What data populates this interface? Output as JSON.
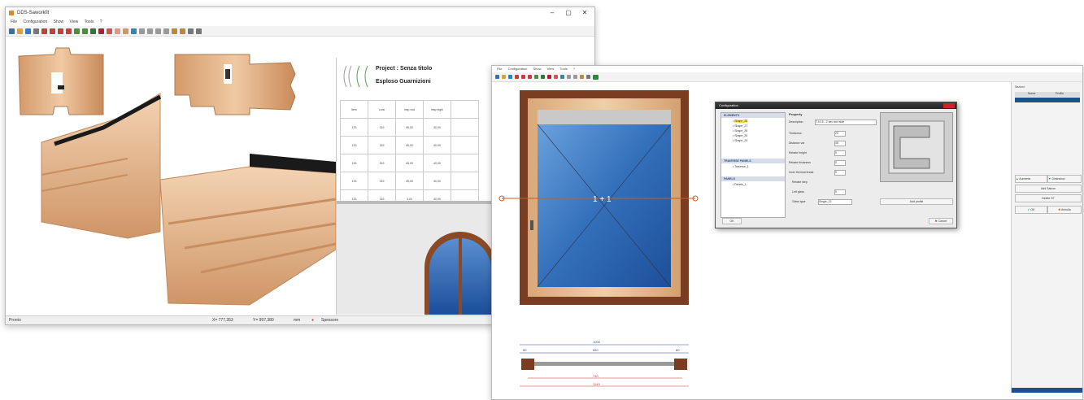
{
  "window1": {
    "title": "DDS-Saworkfit",
    "menu": [
      "File",
      "Configuration",
      "Show",
      "View",
      "Tools",
      "?"
    ],
    "status_left": "Pronto",
    "status_x": "X= 777,353",
    "status_y": "Y= 997,380",
    "status_unit": "mm",
    "status_right": "Spessore"
  },
  "report": {
    "line1": "Project : Senza titolo",
    "line2": "Esploso Guarnizioni",
    "headers": [
      "Item",
      "Lunc",
      "Insp cod",
      "Insp leghi",
      ""
    ],
    "rows": [
      [
        "133",
        "319",
        "45,00",
        "40,00",
        ""
      ],
      [
        "133",
        "319",
        "45,00",
        "40,00",
        ""
      ],
      [
        "133",
        "319",
        "45,00",
        "40,00",
        ""
      ],
      [
        "133",
        "319",
        "45,00",
        "40,00",
        ""
      ],
      [
        "133",
        "319",
        "4,00",
        "40,00",
        ""
      ]
    ]
  },
  "window2": {
    "menu": [
      "File",
      "Configuration",
      "Show",
      "View",
      "Tools",
      "?"
    ],
    "window_label": "1 + 1",
    "right_panel": {
      "header": "Sezioni",
      "col1": "Nome",
      "col2": "Profilo",
      "btn_up": "Aumenta",
      "btn_down": "Diminuisci",
      "btn_add": "Add Saloon",
      "btn_delete": "Delete ST",
      "btn_ok": "OK",
      "btn_cancel": "Annulla"
    },
    "dimensions": {
      "top": "1000",
      "second": "840",
      "left_small": "80",
      "right_small": "80",
      "bottom1": "740",
      "bottom2": "1140"
    }
  },
  "dialog": {
    "title": "Configuration",
    "list_header": "ELEMENTS",
    "list_items": [
      "Shape_25",
      "Shape_27",
      "Shape_28",
      "Shape_26",
      "Shape_24"
    ],
    "section2": "TRAVERSE PANELS",
    "section2_item": "Traverse_1",
    "section3": "PANELS",
    "section3_item": "Panels_1",
    "ok": "OK",
    "property_title": "Property",
    "props": [
      {
        "label": "Description",
        "value": "T.10.5 - 2 sec rect side"
      },
      {
        "label": "Thickness",
        "value": "20"
      },
      {
        "label": "Distance var",
        "value": "45"
      },
      {
        "label": "Rebate height",
        "value": "0"
      },
      {
        "label": "Rebate thickness",
        "value": "0"
      },
      {
        "label": "Inner thermal break",
        "value": "0"
      },
      {
        "label": "Rebate step",
        "value": ""
      },
      {
        "label": "Left glass",
        "value": "0"
      },
      {
        "label": "Glass type",
        "value": "Single_12"
      }
    ],
    "add_profile": "Add profile",
    "cancel": "Cancel"
  }
}
